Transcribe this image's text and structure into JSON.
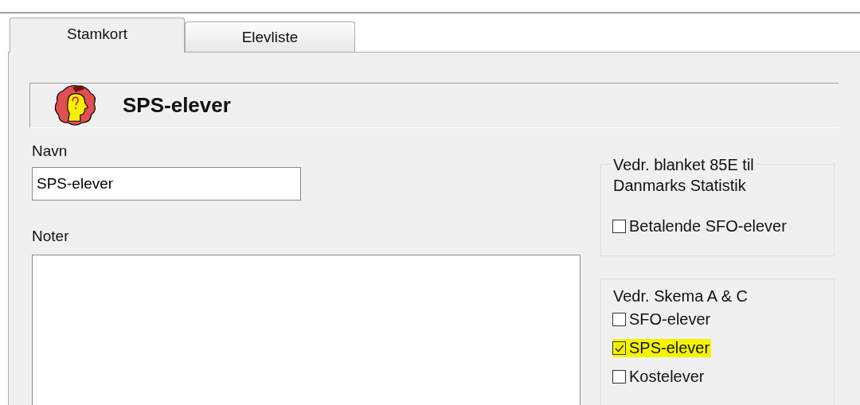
{
  "tabs": [
    {
      "label": "Stamkort",
      "selected": true
    },
    {
      "label": "Elevliste",
      "selected": false
    }
  ],
  "header": {
    "title": "SPS-elever"
  },
  "name_field": {
    "label": "Navn",
    "value": "SPS-elever"
  },
  "notes_field": {
    "label": "Noter"
  },
  "groups": [
    {
      "legend": [
        "Vedr. blanket 85E til",
        "Danmarks Statistik"
      ],
      "options": [
        {
          "label": "Betalende SFO-elever",
          "checked": false,
          "highlighted": false
        }
      ]
    },
    {
      "legend": [
        "Vedr. Skema A & C"
      ],
      "options": [
        {
          "label": "SFO-elever",
          "checked": false,
          "highlighted": false
        },
        {
          "label": "SPS-elever",
          "checked": true,
          "highlighted": true
        },
        {
          "label": "Kostelever",
          "checked": false,
          "highlighted": false
        }
      ]
    }
  ]
}
